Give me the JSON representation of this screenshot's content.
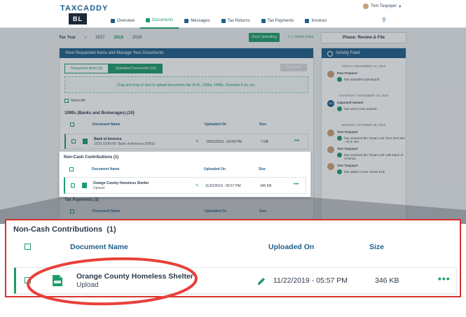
{
  "app": {
    "brand": "TAXCADDY",
    "brand_box": "BL",
    "user_name": "Tom Taxpayer",
    "user_chevron": "▾",
    "search_icon": "⚲",
    "nav_tabs": [
      {
        "label": "Overview",
        "icon": "home-icon"
      },
      {
        "label": "Documents",
        "icon": "document-icon",
        "active": true
      },
      {
        "label": "Messages",
        "icon": "message-icon"
      },
      {
        "label": "Tax Returns",
        "icon": "return-icon"
      },
      {
        "label": "Tax Payments",
        "icon": "payment-icon"
      },
      {
        "label": "Invoices",
        "icon": "invoice-icon"
      }
    ]
  },
  "toolbar": {
    "tax_year_label": "Tax Year",
    "years": [
      "2017",
      "2018",
      "2019"
    ],
    "active_year": "2018",
    "year_chevron": "›",
    "done_uploading": "Done Uploading",
    "smart_links": "Smart Links",
    "smart_links_icon": "⊂⊃",
    "phase": "Phase: Review & File"
  },
  "documents": {
    "panel_title": "View Requested Items and Manage Your Documents",
    "tab_requested": "Requested Items (5)",
    "tab_uploaded": "Uploaded Documents (14)",
    "download": "Download",
    "dropzone": "Drag and drop or click to upload documents like W-2s, 1099s, 1098s, Schedule K-1s, etc.",
    "select_all": "Select All",
    "group_1099": "1099s (Banks and Brokerages)   (10)",
    "col_document_name": "Document Name",
    "col_uploaded_on": "Uploaded On",
    "col_size": "Size",
    "row_bank": {
      "name": "Bank of America",
      "subtitle": "2019 1099-INT Bank of America (0002)",
      "uploaded_on": "10/01/2019 - 03:08 PM",
      "size": "7 KB"
    },
    "group_tax_payments": "Tax Payments   (1)"
  },
  "highlight": {
    "group_title": "Non-Cash Contributions",
    "group_count": "(1)",
    "row": {
      "name": "Orange County Homeless Shelter",
      "subtitle": "Upload",
      "uploaded_on": "11/22/2019 - 05:57 PM",
      "size": "346 KB",
      "more": "•••",
      "pencil": "✎"
    }
  },
  "feed": {
    "title": "Activity Feed",
    "entries": [
      {
        "day": "FRIDAY, NOVEMBER 22, 2019",
        "name": "Pam Preparer",
        "text": "has uploaded Upload.pdf",
        "initials": ""
      },
      {
        "day": "SATURDAY, NOVEMBER 16, 2019",
        "name": "Gajanand Sawant",
        "text": "has sent a new request.",
        "initials": "GS"
      },
      {
        "day": "MONDAY, OCTOBER 28, 2019",
        "name": "Tom Taxpayer",
        "text": "has renamed the 'Smart Link' from Test Site - All in one",
        "initials": ""
      },
      {
        "day": "",
        "name": "Tom Taxpayer",
        "text": "has renamed the 'Smart Link' with Bank of America",
        "initials": ""
      },
      {
        "day": "",
        "name": "Tom Taxpayer",
        "text": "has added a new 'Smart Link'",
        "initials": ""
      }
    ]
  },
  "colors": {
    "accent_green": "#1f9c6b",
    "header_blue": "#1f5f8b",
    "highlight_red": "#d7322b"
  }
}
